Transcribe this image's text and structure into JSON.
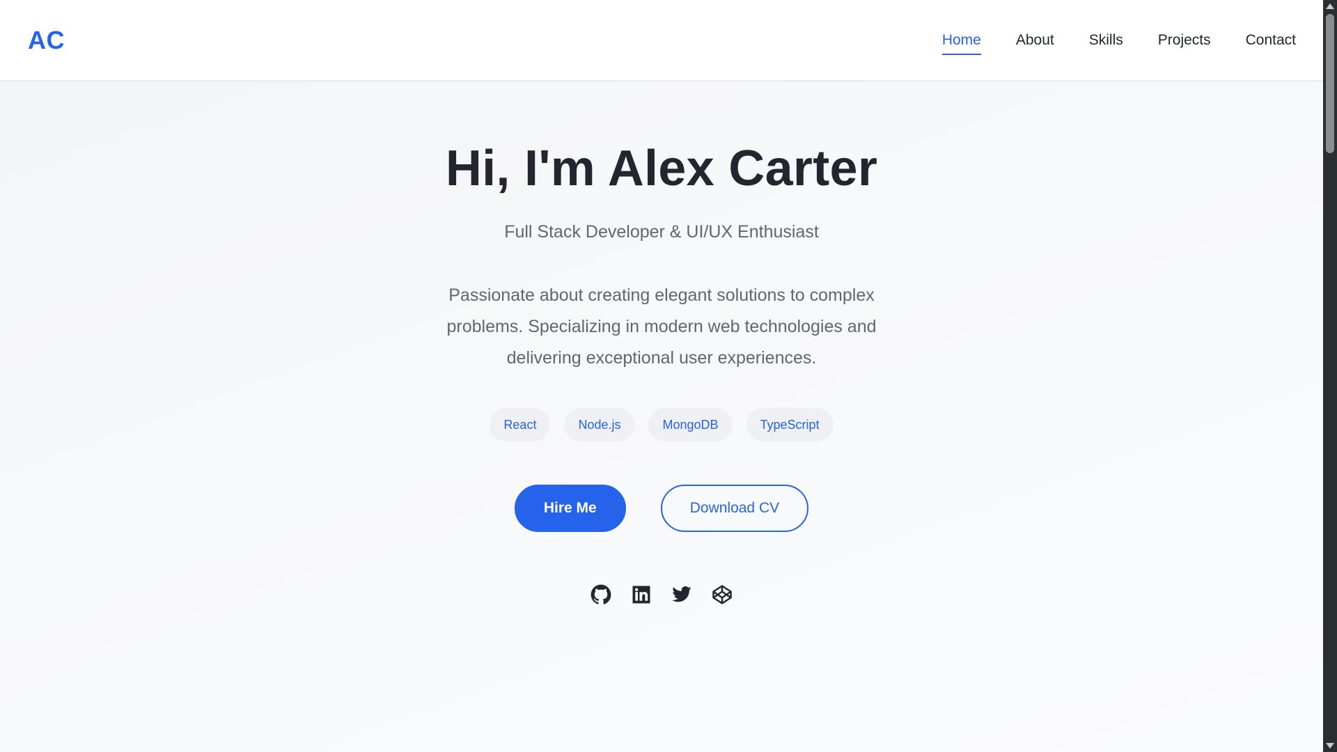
{
  "brand": {
    "logo": "AC",
    "accent_color": "#2563eb"
  },
  "nav": {
    "items": [
      {
        "label": "Home",
        "active": true
      },
      {
        "label": "About",
        "active": false
      },
      {
        "label": "Skills",
        "active": false
      },
      {
        "label": "Projects",
        "active": false
      },
      {
        "label": "Contact",
        "active": false
      }
    ]
  },
  "hero": {
    "title": "Hi, I'm Alex Carter",
    "subtitle": "Full Stack Developer & UI/UX Enthusiast",
    "description": "Passionate about creating elegant solutions to complex problems. Specializing in modern web technologies and delivering exceptional user experiences.",
    "tags": [
      "React",
      "Node.js",
      "MongoDB",
      "TypeScript"
    ],
    "primary_button": "Hire Me",
    "secondary_button": "Download CV"
  },
  "socials": [
    {
      "icon": "github-icon"
    },
    {
      "icon": "linkedin-icon"
    },
    {
      "icon": "twitter-icon"
    },
    {
      "icon": "codepen-icon"
    }
  ]
}
